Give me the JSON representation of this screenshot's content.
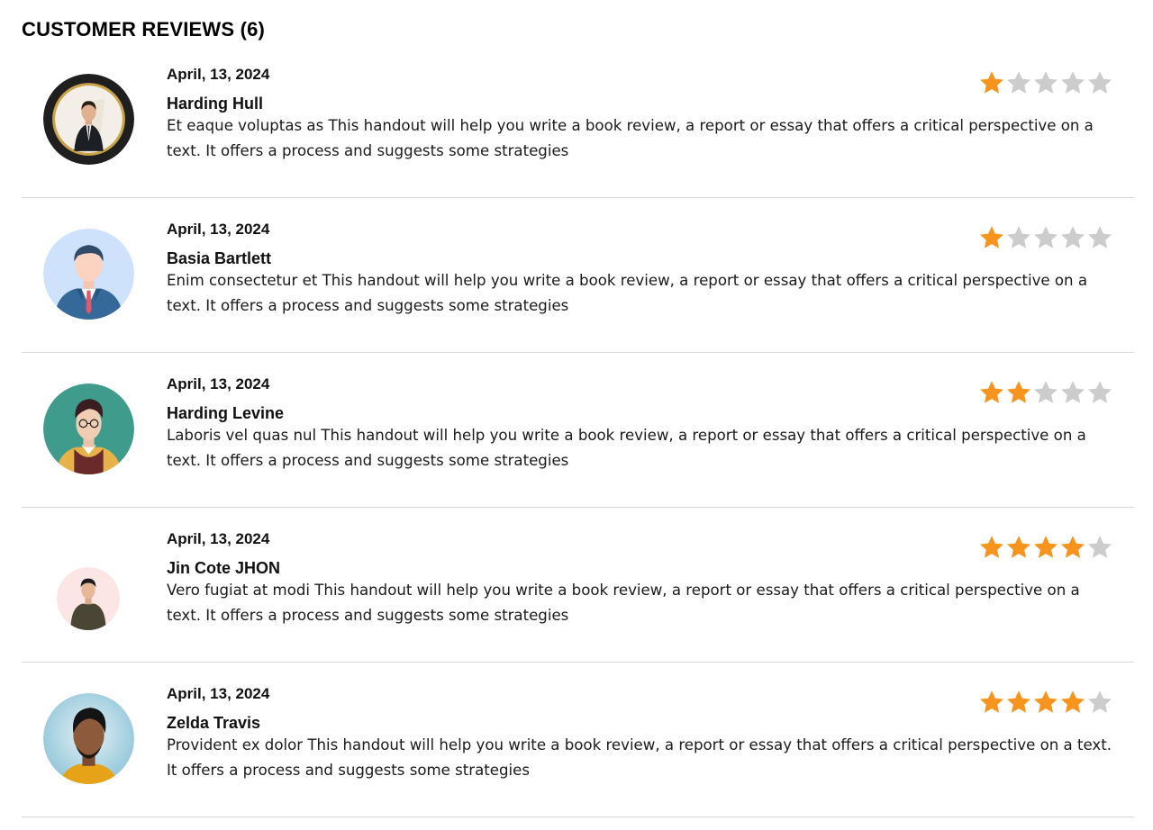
{
  "page": {
    "title": "CUSTOMER REVIEWS (6)"
  },
  "colors": {
    "star_filled": "#f7941d",
    "star_empty": "#cccccc",
    "divider": "#d9d9d9"
  },
  "reviews": [
    {
      "date": "April, 13, 2024",
      "name": "Harding Hull",
      "text": "Et eaque voluptas as This handout will help you write a book review, a report or essay that offers a critical perspective on a text. It offers a process and suggests some strategies",
      "rating": 1,
      "avatar_icon": "man-in-suit-photo-avatar"
    },
    {
      "date": "April, 13, 2024",
      "name": "Basia Bartlett",
      "text": "Enim consectetur et This handout will help you write a book review, a report or essay that offers a critical perspective on a text. It offers a process and suggests some strategies",
      "rating": 1,
      "avatar_icon": "businessman-illustration-avatar"
    },
    {
      "date": "April, 13, 2024",
      "name": "Harding Levine",
      "text": "Laboris vel quas nul This handout will help you write a book review, a report or essay that offers a critical perspective on a text. It offers a process and suggests some strategies",
      "rating": 2,
      "avatar_icon": "man-with-glasses-illustration-avatar"
    },
    {
      "date": "April, 13, 2024",
      "name": "Jin Cote JHON",
      "text": "Vero fugiat at modi This handout will help you write a book review, a report or essay that offers a critical perspective on a text. It offers a process and suggests some strategies",
      "rating": 4,
      "avatar_icon": "man-sweater-illustration-avatar"
    },
    {
      "date": "April, 13, 2024",
      "name": "Zelda Travis",
      "text": "Provident ex dolor This handout will help you write a book review, a report or essay that offers a critical perspective on a text. It offers a process and suggests some strategies",
      "rating": 4,
      "avatar_icon": "man-photo-avatar"
    }
  ]
}
